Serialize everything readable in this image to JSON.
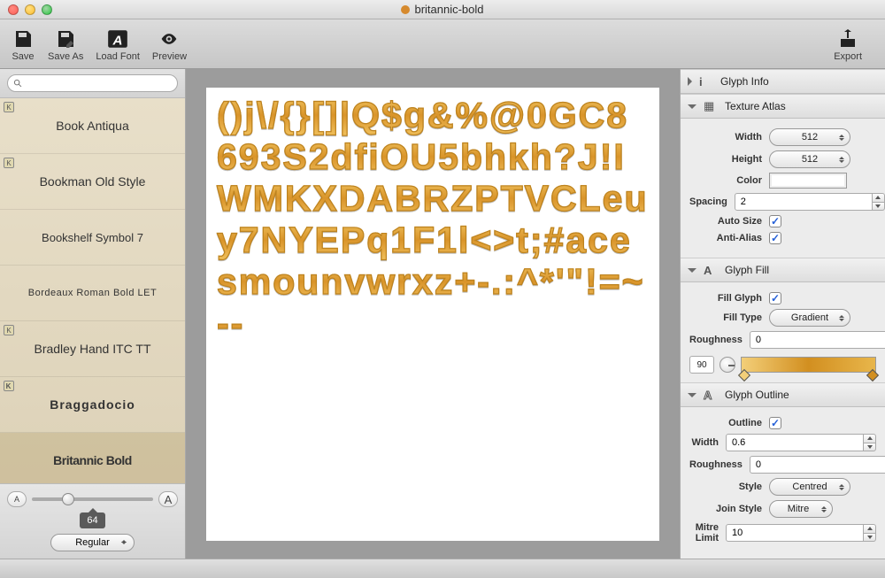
{
  "window": {
    "title": "britannic-bold"
  },
  "toolbar": {
    "save": "Save",
    "save_as": "Save As",
    "load_font": "Load Font",
    "preview": "Preview",
    "export": "Export"
  },
  "search": {
    "placeholder": ""
  },
  "fonts": [
    {
      "name": "Book Antiqua",
      "k": true
    },
    {
      "name": "Bookman Old Style",
      "k": true
    },
    {
      "name": "Bookshelf Symbol 7",
      "k": false
    },
    {
      "name": "Bordeaux Roman Bold LET",
      "k": false
    },
    {
      "name": "Bradley Hand ITC TT",
      "k": true
    },
    {
      "name": "Braggadocio",
      "k": true
    },
    {
      "name": "Britannic Bold",
      "k": false
    }
  ],
  "size": {
    "value": "64",
    "slider_pct": 25,
    "style": "Regular"
  },
  "glyphs": "()j\\/{}[]|Q$g&%@0GC8693S2dfiOU5bhkh?J!IWMKXDABRZPTVCLeuy7NYEPq1F1l<>t;#acesmounvwrxz+-.:^*'\"!=~--",
  "panels": {
    "glyph_info": {
      "title": "Glyph Info"
    },
    "texture_atlas": {
      "title": "Texture Atlas",
      "width_label": "Width",
      "width_value": "512",
      "height_label": "Height",
      "height_value": "512",
      "color_label": "Color",
      "spacing_label": "Spacing",
      "spacing_value": "2",
      "autosize_label": "Auto Size",
      "autosize_on": true,
      "antialias_label": "Anti-Alias",
      "antialias_on": true
    },
    "glyph_fill": {
      "title": "Glyph Fill",
      "fill_glyph_label": "Fill Glyph",
      "fill_glyph_on": true,
      "fill_type_label": "Fill Type",
      "fill_type_value": "Gradient",
      "roughness_label": "Roughness",
      "roughness_value": "0",
      "angle_value": "90"
    },
    "glyph_outline": {
      "title": "Glyph Outline",
      "outline_label": "Outline",
      "outline_on": true,
      "width_label": "Width",
      "width_value": "0.6",
      "roughness_label": "Roughness",
      "roughness_value": "0",
      "style_label": "Style",
      "style_value": "Centred",
      "join_label": "Join Style",
      "join_value": "Mitre",
      "mitre_label": "Mitre Limit",
      "mitre_value": "10"
    }
  }
}
